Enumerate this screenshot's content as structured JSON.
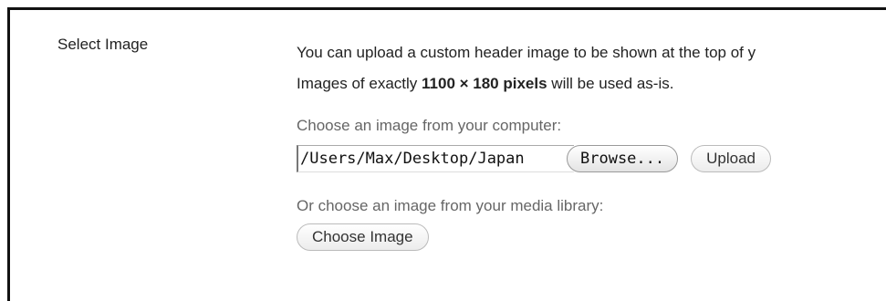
{
  "section": {
    "label": "Select Image"
  },
  "description": {
    "line1": "You can upload a custom header image to be shown at the top of y",
    "line2_prefix": "Images of exactly ",
    "line2_bold": "1100 × 180 pixels",
    "line2_suffix": " will be used as-is."
  },
  "upload": {
    "hint": "Choose an image from your computer:",
    "file_path_value": "/Users/Max/Desktop/Japan",
    "browse_label": "Browse...",
    "upload_label": "Upload"
  },
  "library": {
    "hint": "Or choose an image from your media library:",
    "choose_label": "Choose Image"
  }
}
